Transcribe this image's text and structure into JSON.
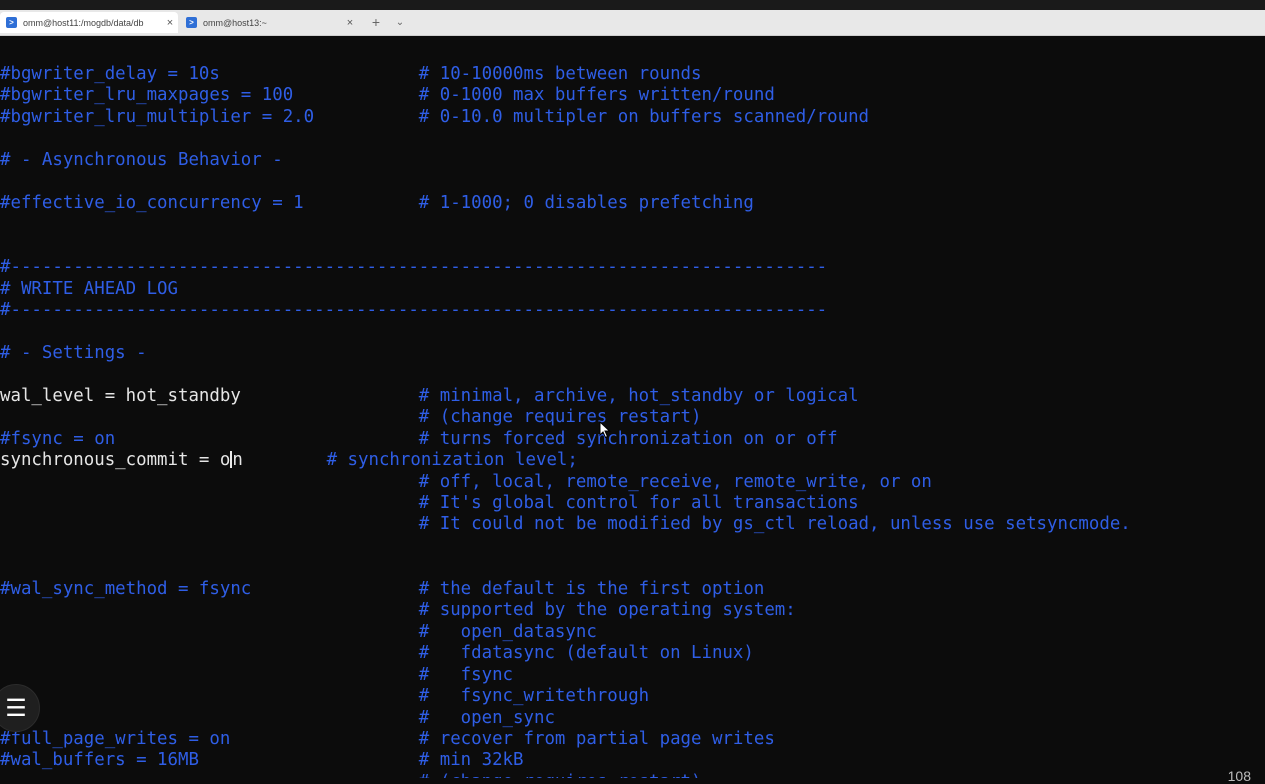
{
  "tabs": [
    {
      "title": "omm@host11:/mogdb/data/db",
      "close": "×",
      "icon": "terminal-icon",
      "active": true
    },
    {
      "title": "omm@host13:~",
      "close": "×",
      "icon": "terminal-icon",
      "active": false
    }
  ],
  "tabstrip": {
    "new_tab": "+",
    "dropdown": "⌄"
  },
  "terminal": {
    "lines": [
      {
        "segments": [
          {
            "t": "#bgwriter_delay = 10s                   # 10-10000ms between rounds",
            "c": "c"
          }
        ]
      },
      {
        "segments": [
          {
            "t": "#bgwriter_lru_maxpages = 100            # 0-1000 max buffers written/round",
            "c": "c"
          }
        ]
      },
      {
        "segments": [
          {
            "t": "#bgwriter_lru_multiplier = 2.0          # 0-10.0 multipler on buffers scanned/round",
            "c": "c"
          }
        ]
      },
      {
        "segments": [
          {
            "t": "",
            "c": "c"
          }
        ]
      },
      {
        "segments": [
          {
            "t": "# - Asynchronous Behavior -",
            "c": "c"
          }
        ]
      },
      {
        "segments": [
          {
            "t": "",
            "c": "c"
          }
        ]
      },
      {
        "segments": [
          {
            "t": "#effective_io_concurrency = 1           # 1-1000; 0 disables prefetching",
            "c": "c"
          }
        ]
      },
      {
        "segments": [
          {
            "t": "",
            "c": "c"
          }
        ]
      },
      {
        "segments": [
          {
            "t": "",
            "c": "c"
          }
        ]
      },
      {
        "segments": [
          {
            "t": "#------------------------------------------------------------------------------",
            "c": "c"
          }
        ]
      },
      {
        "segments": [
          {
            "t": "# WRITE AHEAD LOG",
            "c": "c"
          }
        ]
      },
      {
        "segments": [
          {
            "t": "#------------------------------------------------------------------------------",
            "c": "c"
          }
        ]
      },
      {
        "segments": [
          {
            "t": "",
            "c": "c"
          }
        ]
      },
      {
        "segments": [
          {
            "t": "# - Settings -",
            "c": "c"
          }
        ]
      },
      {
        "segments": [
          {
            "t": "",
            "c": "c"
          }
        ]
      },
      {
        "segments": [
          {
            "t": "wal_level = hot_standby",
            "c": "w"
          },
          {
            "t": "                 # minimal, archive, hot_standby or logical",
            "c": "c"
          }
        ]
      },
      {
        "segments": [
          {
            "t": "                                        # (change requires restart)",
            "c": "c"
          }
        ]
      },
      {
        "segments": [
          {
            "t": "#fsync = on                             # turns forced synchronization on or off",
            "c": "c"
          }
        ]
      },
      {
        "segments": [
          {
            "t": "synchronous_commit = o",
            "c": "w"
          },
          {
            "t": "CURSOR",
            "c": "cursor"
          },
          {
            "t": "n",
            "c": "w"
          },
          {
            "t": "        # synchronization level;",
            "c": "c"
          }
        ]
      },
      {
        "segments": [
          {
            "t": "                                        # off, local, remote_receive, remote_write, or on",
            "c": "c"
          }
        ]
      },
      {
        "segments": [
          {
            "t": "                                        # It's global control for all transactions",
            "c": "c"
          }
        ]
      },
      {
        "segments": [
          {
            "t": "                                        # It could not be modified by gs_ctl reload, unless use setsyncmode.",
            "c": "c"
          }
        ]
      },
      {
        "segments": [
          {
            "t": "",
            "c": "c"
          }
        ]
      },
      {
        "segments": [
          {
            "t": "",
            "c": "c"
          }
        ]
      },
      {
        "segments": [
          {
            "t": "#wal_sync_method = fsync                # the default is the first option",
            "c": "c"
          }
        ]
      },
      {
        "segments": [
          {
            "t": "                                        # supported by the operating system:",
            "c": "c"
          }
        ]
      },
      {
        "segments": [
          {
            "t": "                                        #   open_datasync",
            "c": "c"
          }
        ]
      },
      {
        "segments": [
          {
            "t": "                                        #   fdatasync (default on Linux)",
            "c": "c"
          }
        ]
      },
      {
        "segments": [
          {
            "t": "                                        #   fsync",
            "c": "c"
          }
        ]
      },
      {
        "segments": [
          {
            "t": "                                        #   fsync_writethrough",
            "c": "c"
          }
        ]
      },
      {
        "segments": [
          {
            "t": "                                        #   open_sync",
            "c": "c"
          }
        ]
      },
      {
        "segments": [
          {
            "t": "#full_page_writes = on                  # recover from partial page writes",
            "c": "c"
          }
        ]
      },
      {
        "segments": [
          {
            "t": "#wal_buffers = 16MB                     # min 32kB",
            "c": "c"
          }
        ]
      },
      {
        "segments": [
          {
            "t": "                                        # (change requires restart)",
            "c": "c"
          }
        ]
      }
    ]
  },
  "float_button": {
    "icon": "list-icon",
    "glyph": "☰"
  },
  "page_number": "108"
}
